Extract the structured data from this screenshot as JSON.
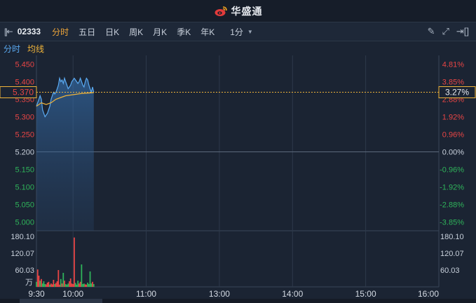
{
  "app": {
    "brand": "华盛通"
  },
  "toolbar": {
    "code": "02333",
    "tabs": [
      "分时",
      "五日",
      "日K",
      "周K",
      "月K",
      "季K",
      "年K"
    ],
    "active_tab": 0,
    "interval": "1分"
  },
  "legend": {
    "time_label": "分时",
    "avg_label": "均线"
  },
  "colors": {
    "price_line": "#5aa9f0",
    "avg_line": "#f0b43a",
    "up": "#e84545",
    "down": "#2fb35a",
    "neutral": "#c9d1dc",
    "background": "#1b2433"
  },
  "chart_data": {
    "type": "line",
    "prev_close": 5.2,
    "price_ticks": [
      "5.450",
      "5.400",
      "5.350",
      "5.300",
      "5.250",
      "5.200",
      "5.150",
      "5.100",
      "5.050",
      "5.000"
    ],
    "percent_ticks": [
      "4.81%",
      "3.85%",
      "2.88%",
      "1.92%",
      "0.96%",
      "0.00%",
      "-0.96%",
      "-1.92%",
      "-2.88%",
      "-3.85%"
    ],
    "ylim": [
      4.975,
      5.475
    ],
    "current_price": "5.370",
    "current_change": "3.27%",
    "time_labels": [
      "9:30",
      "10:00",
      "11:00",
      "13:00",
      "14:00",
      "15:00",
      "16:00"
    ],
    "x_sessions": [
      0,
      30,
      90,
      150,
      210,
      270,
      330
    ],
    "series": [
      {
        "name": "分时",
        "minutes": [
          0,
          1,
          2,
          3,
          4,
          5,
          6,
          7,
          8,
          9,
          10,
          11,
          12,
          13,
          14,
          15,
          16,
          17,
          18,
          19,
          20,
          21,
          22,
          23,
          24,
          25,
          26,
          27,
          28,
          29,
          30,
          31,
          32,
          33,
          34,
          35,
          36,
          37,
          38,
          39,
          40,
          41,
          42,
          43,
          44,
          45,
          46,
          47
        ],
        "values": [
          5.33,
          5.34,
          5.35,
          5.36,
          5.35,
          5.32,
          5.31,
          5.3,
          5.305,
          5.31,
          5.32,
          5.33,
          5.35,
          5.36,
          5.37,
          5.365,
          5.37,
          5.38,
          5.39,
          5.41,
          5.4,
          5.405,
          5.395,
          5.41,
          5.4,
          5.39,
          5.38,
          5.385,
          5.39,
          5.4,
          5.405,
          5.41,
          5.405,
          5.4,
          5.395,
          5.4,
          5.41,
          5.4,
          5.39,
          5.385,
          5.4,
          5.41,
          5.405,
          5.39,
          5.38,
          5.37,
          5.385,
          5.37
        ]
      },
      {
        "name": "均线",
        "minutes": [
          0,
          4,
          8,
          12,
          16,
          20,
          24,
          28,
          32,
          36,
          40,
          44,
          47
        ],
        "values": [
          5.33,
          5.34,
          5.335,
          5.34,
          5.35,
          5.355,
          5.36,
          5.362,
          5.364,
          5.366,
          5.367,
          5.368,
          5.369
        ]
      }
    ],
    "volume": {
      "ticks": [
        "180.10",
        "120.07",
        "60.03"
      ],
      "unit": "万",
      "max": 180.1,
      "minutes": [
        0,
        1,
        2,
        3,
        4,
        5,
        6,
        7,
        8,
        9,
        10,
        11,
        12,
        13,
        14,
        15,
        16,
        17,
        18,
        19,
        20,
        21,
        22,
        23,
        24,
        25,
        26,
        27,
        28,
        29,
        30,
        31,
        32,
        33,
        34,
        35,
        36,
        37,
        38,
        39,
        40,
        41,
        42,
        43,
        44,
        45,
        46,
        47
      ],
      "values": [
        18,
        62,
        40,
        22,
        28,
        12,
        20,
        10,
        9,
        15,
        18,
        8,
        12,
        9,
        25,
        10,
        14,
        20,
        60,
        8,
        28,
        12,
        50,
        22,
        10,
        8,
        12,
        20,
        30,
        12,
        10,
        176,
        14,
        8,
        22,
        12,
        18,
        80,
        10,
        12,
        9,
        8,
        15,
        10,
        55,
        12,
        18,
        10
      ],
      "up": [
        0,
        1,
        1,
        0,
        1,
        0,
        0,
        0,
        1,
        1,
        1,
        0,
        1,
        1,
        1,
        0,
        1,
        1,
        1,
        1,
        0,
        1,
        0,
        1,
        0,
        0,
        0,
        1,
        1,
        1,
        1,
        1,
        0,
        0,
        0,
        1,
        1,
        0,
        0,
        0,
        1,
        1,
        0,
        0,
        0,
        0,
        1,
        0
      ]
    }
  }
}
